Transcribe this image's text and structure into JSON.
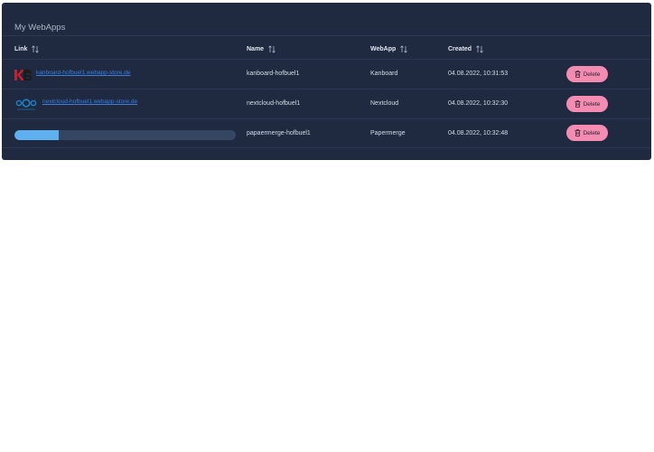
{
  "card": {
    "title": "My WebApps"
  },
  "columns": [
    {
      "label": "Link"
    },
    {
      "label": "Name"
    },
    {
      "label": "WebApp"
    },
    {
      "label": "Created"
    }
  ],
  "rows": [
    {
      "link": "kanboard-hofbuel1.webapp-store.de",
      "logo": "kanboard-logo",
      "name": "kanboard-hofbuel1",
      "webapp": "Kanboard",
      "created": "04.08.2022, 10:31:53",
      "delete_label": "Delete"
    },
    {
      "link": "nextcloud-hofbuel1.webapp-store.de",
      "logo": "nextcloud-logo",
      "name": "nextcloud-hofbuel1",
      "webapp": "Nextcloud",
      "created": "04.08.2022, 10:32:30",
      "delete_label": "Delete"
    },
    {
      "progress": 0.2,
      "name": "papaermerge-hofbuel1",
      "webapp": "Papermerge",
      "created": "04.08.2022, 10:32:48",
      "delete_label": "Delete"
    }
  ],
  "colors": {
    "card_bg": "#1f2a40",
    "link": "#3d7ee0",
    "delete_button": "#f48cb1",
    "progress_fill": "#5fb0ee",
    "progress_track": "#354663"
  },
  "icons": {
    "sort": "sort-arrows-icon",
    "delete": "trash-icon"
  }
}
